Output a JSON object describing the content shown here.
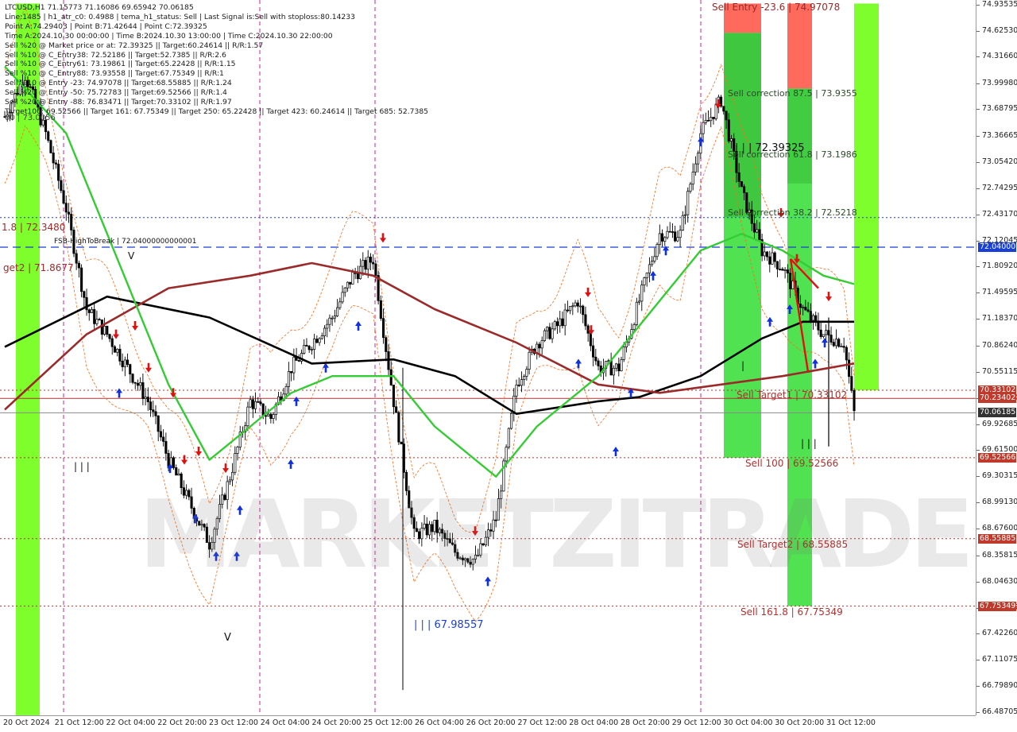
{
  "symbol_header": "LTCUSD,H1  71.15773 71.16086 69.65942 70.06185",
  "info_lines": [
    "Line:1485  |  h1_atr_c0: 0.4988  |  tema_h1_status: Sell  |  Last Signal is:Sell with stoploss:80.14233",
    "Point A:74.29403  |  Point B:71.42644  |  Point C:72.39325",
    "Time A:2024.10.30 00:00:00  |  Time B:2024.10.30 13:00:00  |  Time C:2024.10.30 22:00:00",
    "Sell %20 @ Market price or at: 72.39325  ||  Target:60.24614  ||  R/R:1.57",
    "Sell %10 @ C_Entry38: 72.52186  ||  Target:52.7385  ||  R/R:2.6",
    "Sell %10 @ C_Entry61: 73.19861  ||  Target:65.22428  ||  R/R:1.15",
    "Sell %10 @ C_Entry88: 73.93558  ||  Target:67.75349  ||  R/R:1",
    "Sell %10 @ Entry -23: 74.97078  ||  Target:68.55885  ||  R/R:1.24",
    "Sell %20 @ Entry -50: 75.72783  ||  Target:69.52566  ||  R/R:1.4",
    "Sell %20 @ Entry -88: 76.83471  ||  Target:70.33102  ||  R/R:1.97",
    "Target100: 69.52566  ||  Target 161: 67.75349  ||  Target 250: 65.22428  ||  Target 423: 60.24614  ||  Target 685: 52.7385"
  ],
  "price_ticks": [
    "74.93535",
    "74.62530",
    "74.31660",
    "73.99980",
    "73.68795",
    "73.36665",
    "73.05420",
    "72.74295",
    "72.43170",
    "72.12045",
    "71.80920",
    "71.49595",
    "71.18370",
    "70.86240",
    "70.55115",
    "70.23990",
    "69.92685",
    "69.61500",
    "69.30315",
    "68.99130",
    "68.67600",
    "68.35815",
    "68.04630",
    "67.73445",
    "67.42260",
    "67.11075",
    "66.79890",
    "66.48705"
  ],
  "price_badges": [
    {
      "text": "72.04000",
      "color": "#1a3fd4"
    },
    {
      "text": "70.33102",
      "color": "#c0392b"
    },
    {
      "text": "70.23402",
      "color": "#c0392b"
    },
    {
      "text": "70.06185",
      "color": "#333333"
    },
    {
      "text": "69.52566",
      "color": "#c0392b"
    },
    {
      "text": "68.55885",
      "color": "#c0392b"
    },
    {
      "text": "67.75349",
      "color": "#c0392b"
    }
  ],
  "time_ticks": [
    "20 Oct 2024",
    "21 Oct 12:00",
    "22 Oct 04:00",
    "22 Oct 20:00",
    "23 Oct 12:00",
    "24 Oct 04:00",
    "24 Oct 20:00",
    "25 Oct 12:00",
    "26 Oct 04:00",
    "26 Oct 20:00",
    "27 Oct 12:00",
    "28 Oct 04:00",
    "28 Oct 20:00",
    "29 Oct 12:00",
    "30 Oct 04:00",
    "30 Oct 20:00",
    "31 Oct 12:00"
  ],
  "labels": {
    "sell_entry": "Sell Entry -23.6 | 74.97078",
    "sell_corr_875": "Sell correction 87.5 | 73.9355",
    "sell_corr_618": "Sell correction 61.8 | 73.1986",
    "sell_corr_382": "Sell correction 38.2 | 72.5218",
    "point_c": "| | | 72.39325",
    "sell_target1": "Sell Target1 | 70.33102",
    "sell_100": "Sell 100 | 69.52566",
    "sell_target2": "Sell Target2 | 68.55885",
    "sell_1618": "Sell 161.8 | 67.75349",
    "low_label": "| | | 67.98557",
    "left_target1": "1.8 | 72.3480",
    "left_target2": "get2 | 71.8677",
    "left_top": "00 | 73.0056",
    "fsb": "FSB-HighToBreak  |  72.04000000000001",
    "mark_v_top": "V",
    "mark_v_bottom": "V",
    "bars_left": "| | |",
    "bars_right": "| | |",
    "bar_mid": "|",
    "watermark": "MARKETZITRADE"
  },
  "chart_data": {
    "type": "candlestick",
    "symbol": "LTCUSD",
    "timeframe": "H1",
    "ohlc_last": {
      "open": 71.15773,
      "high": 71.16086,
      "low": 69.65942,
      "close": 70.06185
    },
    "ylim": [
      66.48705,
      74.93535
    ],
    "x_categories": [
      "20 Oct 2024",
      "21 Oct 12:00",
      "22 Oct 04:00",
      "22 Oct 20:00",
      "23 Oct 12:00",
      "24 Oct 04:00",
      "24 Oct 20:00",
      "25 Oct 12:00",
      "26 Oct 04:00",
      "26 Oct 20:00",
      "27 Oct 12:00",
      "28 Oct 04:00",
      "28 Oct 20:00",
      "29 Oct 12:00",
      "30 Oct 04:00",
      "30 Oct 20:00",
      "31 Oct 12:00"
    ],
    "price_path": [
      [
        0,
        73.6
      ],
      [
        8,
        74.1
      ],
      [
        16,
        73.4
      ],
      [
        24,
        72.5
      ],
      [
        32,
        71.3
      ],
      [
        40,
        71.0
      ],
      [
        48,
        70.6
      ],
      [
        56,
        70.2
      ],
      [
        64,
        69.5
      ],
      [
        72,
        69.0
      ],
      [
        80,
        68.5
      ],
      [
        88,
        69.3
      ],
      [
        96,
        70.2
      ],
      [
        104,
        70.0
      ],
      [
        112,
        70.6
      ],
      [
        120,
        70.9
      ],
      [
        128,
        71.2
      ],
      [
        136,
        71.7
      ],
      [
        144,
        71.9
      ],
      [
        152,
        70.2
      ],
      [
        160,
        68.6
      ],
      [
        168,
        68.7
      ],
      [
        176,
        68.4
      ],
      [
        184,
        68.3
      ],
      [
        192,
        68.8
      ],
      [
        200,
        70.4
      ],
      [
        208,
        70.9
      ],
      [
        216,
        71.1
      ],
      [
        224,
        71.4
      ],
      [
        232,
        70.6
      ],
      [
        240,
        70.6
      ],
      [
        248,
        71.4
      ],
      [
        256,
        72.2
      ],
      [
        264,
        72.2
      ],
      [
        272,
        73.4
      ],
      [
        280,
        73.8
      ],
      [
        288,
        72.7
      ],
      [
        296,
        72.0
      ],
      [
        304,
        71.8
      ],
      [
        312,
        71.3
      ],
      [
        320,
        71.0
      ],
      [
        328,
        70.9
      ],
      [
        332,
        70.06
      ]
    ],
    "series": [
      {
        "name": "black_ma",
        "values": [
          [
            0,
            70.85
          ],
          [
            40,
            71.45
          ],
          [
            80,
            71.2
          ],
          [
            120,
            70.65
          ],
          [
            152,
            70.7
          ],
          [
            176,
            70.5
          ],
          [
            200,
            70.05
          ],
          [
            232,
            70.2
          ],
          [
            248,
            70.25
          ],
          [
            272,
            70.5
          ],
          [
            296,
            70.95
          ],
          [
            312,
            71.15
          ],
          [
            332,
            71.15
          ]
        ]
      },
      {
        "name": "darkred_ma",
        "values": [
          [
            0,
            70.1
          ],
          [
            32,
            71.0
          ],
          [
            64,
            71.55
          ],
          [
            96,
            71.7
          ],
          [
            120,
            71.85
          ],
          [
            144,
            71.7
          ],
          [
            168,
            71.3
          ],
          [
            200,
            70.9
          ],
          [
            232,
            70.4
          ],
          [
            256,
            70.3
          ],
          [
            280,
            70.4
          ],
          [
            304,
            70.5
          ],
          [
            332,
            70.65
          ]
        ]
      },
      {
        "name": "green_ma",
        "values": [
          [
            0,
            74.2
          ],
          [
            24,
            73.4
          ],
          [
            48,
            71.6
          ],
          [
            64,
            70.4
          ],
          [
            80,
            69.5
          ],
          [
            96,
            69.9
          ],
          [
            112,
            70.3
          ],
          [
            128,
            70.5
          ],
          [
            152,
            70.5
          ],
          [
            168,
            69.9
          ],
          [
            192,
            69.3
          ],
          [
            208,
            69.9
          ],
          [
            232,
            70.5
          ],
          [
            256,
            71.4
          ],
          [
            272,
            72.0
          ],
          [
            288,
            72.2
          ],
          [
            304,
            72.0
          ],
          [
            320,
            71.7
          ],
          [
            332,
            71.6
          ]
        ]
      }
    ],
    "levels": [
      {
        "name": "Sell Entry -23.6",
        "value": 74.97078
      },
      {
        "name": "Sell correction 87.5",
        "value": 73.9355
      },
      {
        "name": "Sell correction 61.8",
        "value": 73.1986
      },
      {
        "name": "Sell correction 38.2",
        "value": 72.5218
      },
      {
        "name": "Point C",
        "value": 72.39325
      },
      {
        "name": "FSB-HighToBreak",
        "value": 72.04
      },
      {
        "name": "Sell Target1",
        "value": 70.33102
      },
      {
        "name": "Sell 100",
        "value": 69.52566
      },
      {
        "name": "Sell Target2",
        "value": 68.55885
      },
      {
        "name": "Sell 161.8",
        "value": 67.75349
      }
    ],
    "colors": {
      "green_zone": "#33dd33",
      "lime_zone": "#77ff22",
      "red_zone": "#ff5a4a",
      "black_ma": "#000000",
      "darkred_ma": "#9b2a2a",
      "green_ma": "#33cc33",
      "level_blue": "#1a3fd4",
      "level_red": "#b03030",
      "magenta_vline": "#cc2299"
    }
  }
}
